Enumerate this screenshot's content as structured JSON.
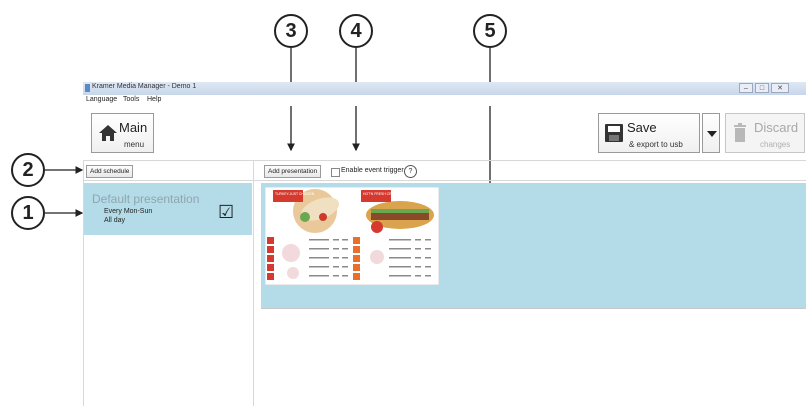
{
  "callouts": {
    "c1": "1",
    "c2": "2",
    "c3": "3",
    "c4": "4",
    "c5": "5"
  },
  "window": {
    "title": "Kramer Media Manager - Demo 1",
    "controls": {
      "minimize": "–",
      "maximize": "□",
      "close": "✕"
    }
  },
  "menu": {
    "language": "Language",
    "tools": "Tools",
    "help": "Help"
  },
  "toolbar": {
    "main_label": "Main",
    "main_sub": "menu",
    "save_label": "Save",
    "save_sub": "& export to usb",
    "discard_label": "Discard",
    "discard_sub": "changes"
  },
  "schedule": {
    "add_button": "Add schedule",
    "item": {
      "title": "Default presentation",
      "days": "Every Mon-Sun",
      "time": "All day",
      "checkbox_mark": "☑"
    }
  },
  "presentation": {
    "add_button": "Add presentation",
    "event_trigger_label": "Enable event trigger",
    "help_mark": "?"
  },
  "thumbnail": {
    "left_header": "TURKEY-JUST CHICKEN",
    "right_header": "HOT'N FRESH CROISSANT"
  },
  "colors": {
    "accent_panel": "#b4dce8",
    "menu_red": "#d63a2f"
  }
}
